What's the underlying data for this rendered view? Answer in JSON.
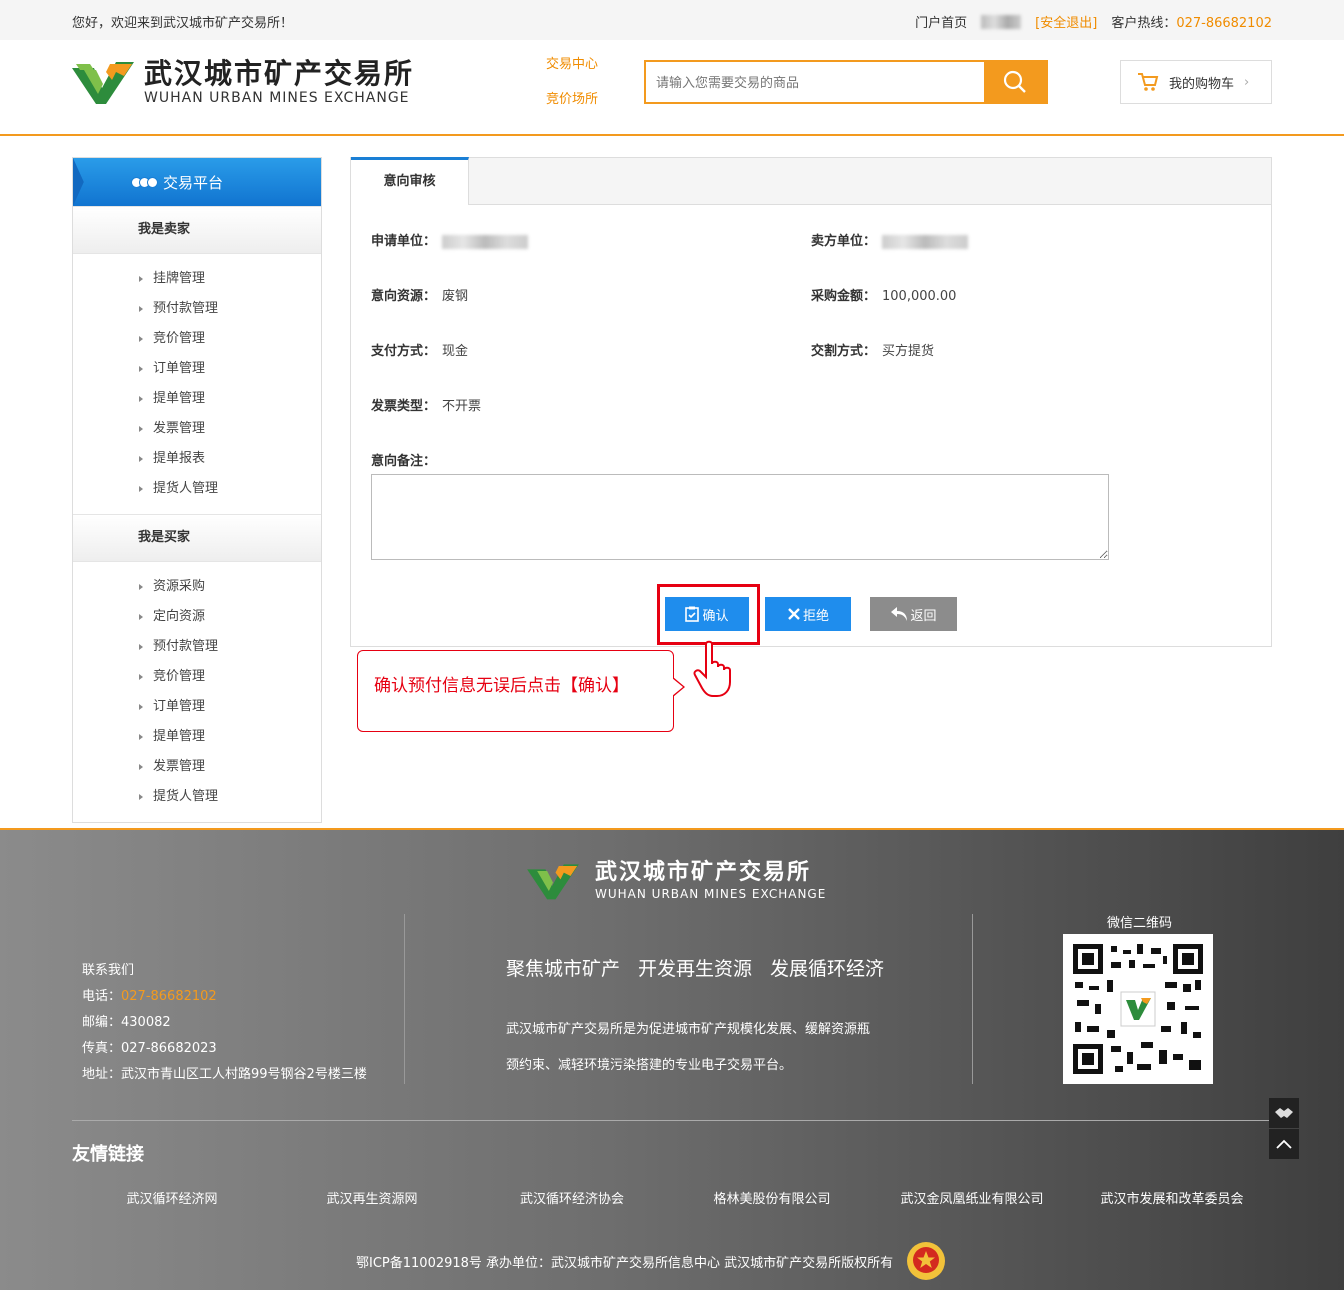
{
  "topbar": {
    "welcome": "您好，欢迎来到武汉城市矿产交易所！",
    "portal_home": "门户首页",
    "logout": "[安全退出]",
    "hotline_label": "客户热线：",
    "hotline": "027-86682102"
  },
  "header": {
    "logo_cn": "武汉城市矿产交易所",
    "logo_en": "WUHAN URBAN MINES EXCHANGE",
    "nav": [
      "交易中心",
      "竞价场所"
    ],
    "search_placeholder": "请输入您需要交易的商品",
    "cart_label": "我的购物车"
  },
  "sidebar": {
    "title": "交易平台",
    "seller": {
      "title": "我是卖家",
      "items": [
        "挂牌管理",
        "预付款管理",
        "竞价管理",
        "订单管理",
        "提单管理",
        "发票管理",
        "提单报表",
        "提货人管理"
      ]
    },
    "buyer": {
      "title": "我是买家",
      "items": [
        "资源采购",
        "定向资源",
        "预付款管理",
        "竞价管理",
        "订单管理",
        "提单管理",
        "发票管理",
        "提货人管理"
      ]
    }
  },
  "panel": {
    "tab": "意向审核",
    "fields": {
      "applicant_label": "申请单位：",
      "seller_label": "卖方单位：",
      "resource_label": "意向资源：",
      "resource_value": "废钢",
      "amount_label": "采购金额：",
      "amount_value": "100,000.00",
      "payment_label": "支付方式：",
      "payment_value": "现金",
      "delivery_label": "交割方式：",
      "delivery_value": "买方提货",
      "invoice_label": "发票类型：",
      "invoice_value": "不开票",
      "remark_label": "意向备注："
    },
    "buttons": {
      "confirm": "确认",
      "reject": "拒绝",
      "back": "返回"
    }
  },
  "callout": "确认预付信息无误后点击【确认】",
  "footer": {
    "logo_cn": "武汉城市矿产交易所",
    "logo_en": "WUHAN URBAN MINES EXCHANGE",
    "contact_title": "联系我们",
    "phone_label": "电话：",
    "phone": "027-86682102",
    "zip": "邮编：430082",
    "fax": "传真：027-86682023",
    "address": "地址：武汉市青山区工人村路99号钢谷2号楼三楼",
    "slogan": [
      "聚焦城市矿产",
      "开发再生资源",
      "发展循环经济"
    ],
    "intro": "武汉城市矿产交易所是为促进城市矿产规模化发展、缓解资源瓶颈约束、减轻环境污染搭建的专业电子交易平台。",
    "qr_title": "微信二维码",
    "links_title": "友情链接",
    "links": [
      "武汉循环经济网",
      "武汉再生资源网",
      "武汉循环经济协会",
      "格林美股份有限公司",
      "武汉金凤凰纸业有限公司",
      "武汉市发展和改革委员会"
    ],
    "copyright": "鄂ICP备11002918号  承办单位：武汉城市矿产交易所信息中心  武汉城市矿产交易所版权所有"
  }
}
